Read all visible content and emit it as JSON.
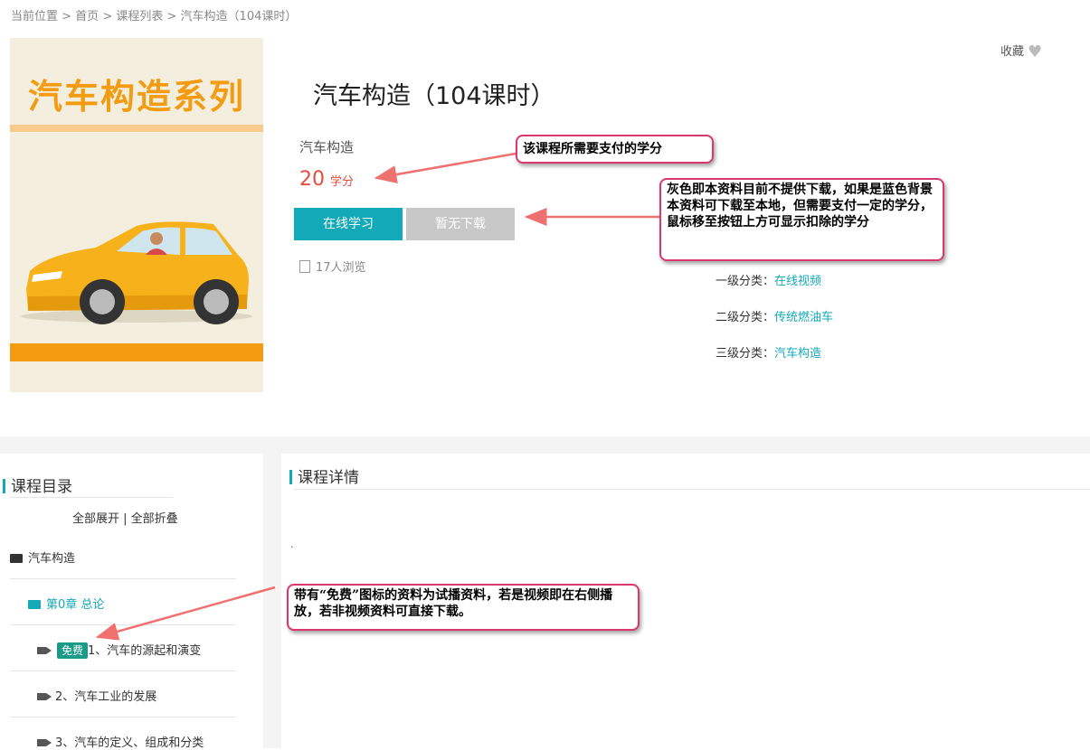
{
  "breadcrumb": {
    "prefix": "当前位置 > ",
    "home": "首页",
    "sep1": " > ",
    "list": "课程列表",
    "sep2": " > ",
    "current": "汽车构造（104课时）"
  },
  "cover": {
    "banner": "汽车构造系列"
  },
  "course": {
    "title": "汽车构造（104课时）",
    "subtitle": "汽车构造",
    "credit_value": "20",
    "credit_unit": "学分",
    "study_button": "在线学习",
    "download_button": "暂无下载",
    "views": "17人浏览"
  },
  "favorite": {
    "label": "收藏"
  },
  "categories": [
    {
      "label": "一级分类：",
      "value": "在线视频"
    },
    {
      "label": "二级分类：",
      "value": "传统燃油车"
    },
    {
      "label": "三级分类：",
      "value": "汽车构造"
    }
  ],
  "callouts": {
    "credit_note": "该课程所需要支付的学分",
    "download_note": "灰色即本资料目前不提供下载，如果是蓝色背景本资料可下载至本地，但需要支付一定的学分，鼠标移至按钮上方可显示扣除的学分",
    "free_note": "带有“免费”图标的资料为试播资料，若是视频即在右侧播放，若非视频资料可直接下载。"
  },
  "catalog": {
    "title": "课程目录",
    "expand_all": "全部展开",
    "divider": " | ",
    "collapse_all": "全部折叠",
    "root": "汽车构造",
    "chapter": "第0章 总论",
    "lessons": [
      {
        "badge": "免费",
        "title": "1、汽车的源起和演变"
      },
      {
        "badge": "",
        "title": "2、汽车工业的发展"
      },
      {
        "badge": "",
        "title": "3、汽车的定义、组成和分类"
      }
    ]
  },
  "detail": {
    "title": "课程详情",
    "content": "."
  },
  "colors": {
    "accent": "#12a9b8",
    "credit": "#e74c3c",
    "callout_border": "#d9376e",
    "free_badge": "#1a9b8a"
  }
}
